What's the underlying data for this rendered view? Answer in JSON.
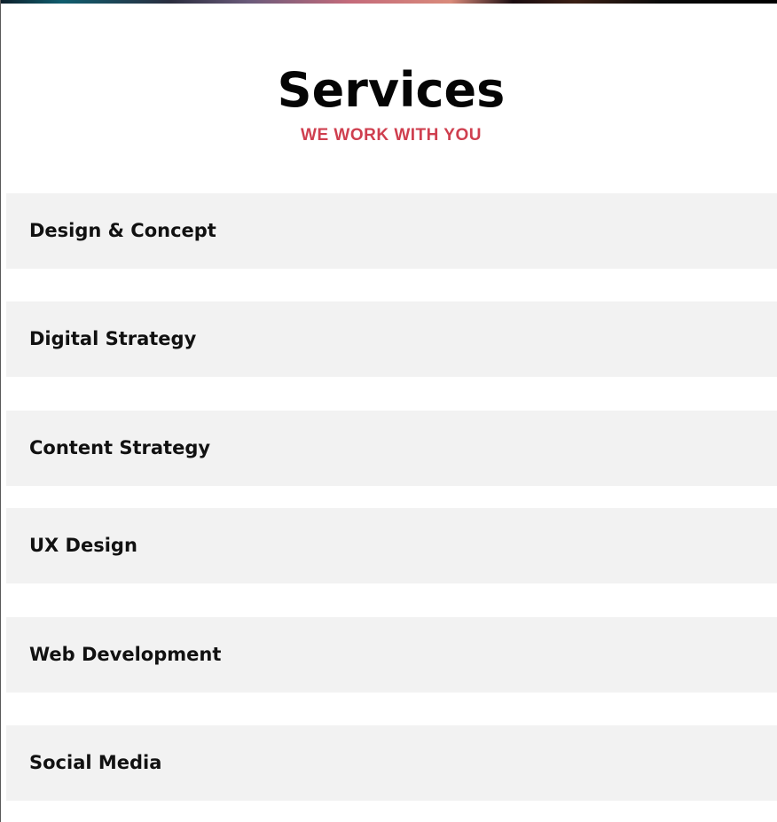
{
  "header": {
    "title": "Services",
    "subtitle": "WE WORK WITH YOU"
  },
  "services": {
    "items": [
      {
        "label": "Design & Concept"
      },
      {
        "label": "Digital Strategy"
      },
      {
        "label": "Content Strategy"
      },
      {
        "label": "UX Design"
      },
      {
        "label": "Web Development"
      },
      {
        "label": "Social Media"
      }
    ]
  },
  "colors": {
    "title": "#050505",
    "subtitle_accent": "#cf3f4f",
    "item_background": "#f2f2f2",
    "item_text": "#111111",
    "page_background": "#ffffff"
  }
}
